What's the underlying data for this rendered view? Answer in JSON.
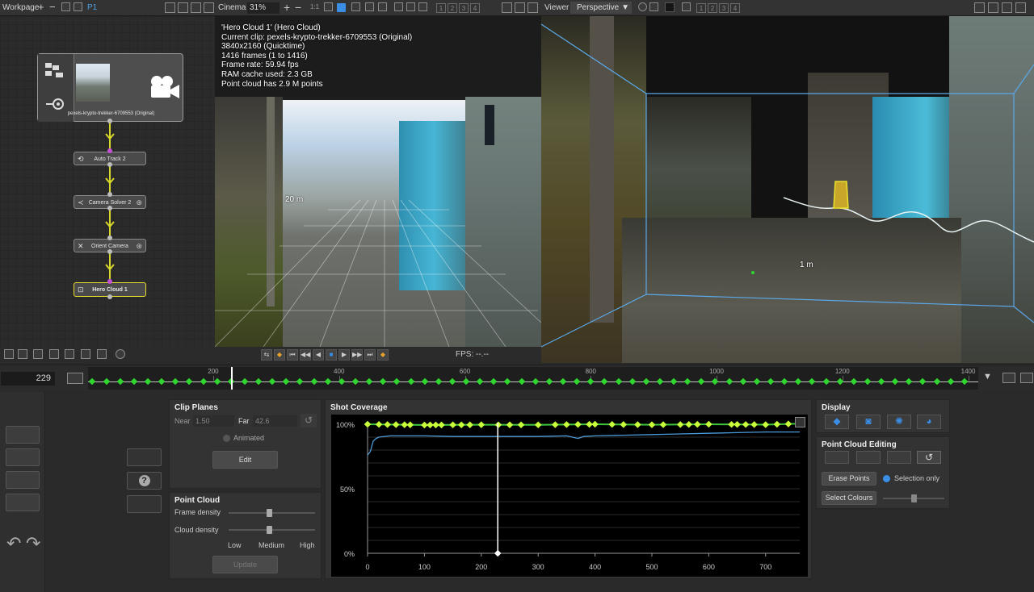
{
  "workpage": {
    "title": "Workpage",
    "page_badge": "P1"
  },
  "nodes": {
    "clip_label": "pexels-krypto-trekker-6709553 (Original)",
    "auto_track": "Auto Track 2",
    "camera_solver": "Camera Solver 2",
    "orient_camera": "Orient Camera",
    "hero_cloud": "Hero Cloud 1"
  },
  "cinema": {
    "title": "Cinema",
    "zoom": "31%",
    "mode_button": "1:1",
    "display_nums": [
      "1",
      "2",
      "3",
      "4"
    ],
    "overlay": [
      "'Hero Cloud 1' (Hero Cloud)",
      "Current clip: pexels-krypto-trekker-6709553 (Original)",
      "3840x2160 (Quicktime)",
      "1416 frames (1 to 1416)",
      "Frame rate: 59.94 fps",
      "RAM cache used: 2.3 GB",
      "Point cloud has 2.9 M points"
    ],
    "distance_label": "20 m",
    "fps": "FPS: --.--"
  },
  "viewer": {
    "title": "Viewer",
    "projection": "Perspective",
    "display_nums": [
      "1",
      "2",
      "3",
      "4"
    ],
    "distance_label": "1 m"
  },
  "timeline": {
    "current_frame": "229",
    "ticks": [
      "200",
      "400",
      "600",
      "800",
      "1000",
      "1200",
      "1400"
    ],
    "playhead_frame": 229,
    "start_frame": 1,
    "end_frame": 1416
  },
  "clip_planes": {
    "title": "Clip Planes",
    "near_label": "Near",
    "near_value": "1.50",
    "far_label": "Far",
    "far_value": "42.6",
    "animated_label": "Animated",
    "edit_button": "Edit"
  },
  "point_cloud": {
    "title": "Point Cloud",
    "frame_density_label": "Frame density",
    "cloud_density_label": "Cloud density",
    "low": "Low",
    "medium": "Medium",
    "high": "High",
    "update_button": "Update",
    "frame_density": 0.5,
    "cloud_density": 0.5
  },
  "shot_coverage": {
    "title": "Shot Coverage",
    "y_labels": [
      "100%",
      "50%",
      "0%"
    ],
    "x_labels": [
      "0",
      "100",
      "200",
      "300",
      "400",
      "500",
      "600",
      "700"
    ]
  },
  "chart_data": {
    "type": "line",
    "xlim": [
      0,
      760
    ],
    "ylim": [
      0,
      100
    ],
    "marker": 229,
    "series": [
      {
        "color": "#3ec43e",
        "x": [
          0,
          100,
          200,
          300,
          400,
          500,
          600,
          700,
          760
        ],
        "y": [
          100,
          99.4,
          99.6,
          99.5,
          100,
          99.6,
          100,
          99.7,
          100.5
        ]
      },
      {
        "color": "#4a9ad8",
        "x": [
          0,
          5,
          10,
          15,
          20,
          40,
          60,
          80,
          100,
          150,
          200,
          250,
          300,
          350,
          370,
          380,
          400,
          450,
          500,
          550,
          600,
          650,
          700,
          760
        ],
        "y": [
          76,
          79,
          87,
          89,
          90,
          91,
          91,
          91,
          91,
          90.5,
          90.5,
          90.5,
          90.5,
          91,
          89,
          90.5,
          91,
          91.5,
          92,
          92.5,
          93,
          93.5,
          94,
          94
        ]
      }
    ],
    "keyframes": [
      0,
      20,
      35,
      50,
      65,
      75,
      100,
      110,
      120,
      130,
      150,
      165,
      180,
      200,
      230,
      250,
      270,
      300,
      330,
      350,
      370,
      390,
      400,
      430,
      450,
      475,
      500,
      520,
      550,
      565,
      580,
      600,
      640,
      650,
      665,
      680,
      700,
      720,
      740,
      760
    ]
  },
  "display": {
    "title": "Display"
  },
  "point_cloud_editing": {
    "title": "Point Cloud Editing",
    "erase_button": "Erase Points",
    "selection_only": "Selection only",
    "select_colours": "Select Colours"
  },
  "colors": {
    "accent": "#3a8ee6",
    "keyframe": "#2fd62f",
    "wire": "#d8d82a",
    "selected": "#e8e02a"
  }
}
